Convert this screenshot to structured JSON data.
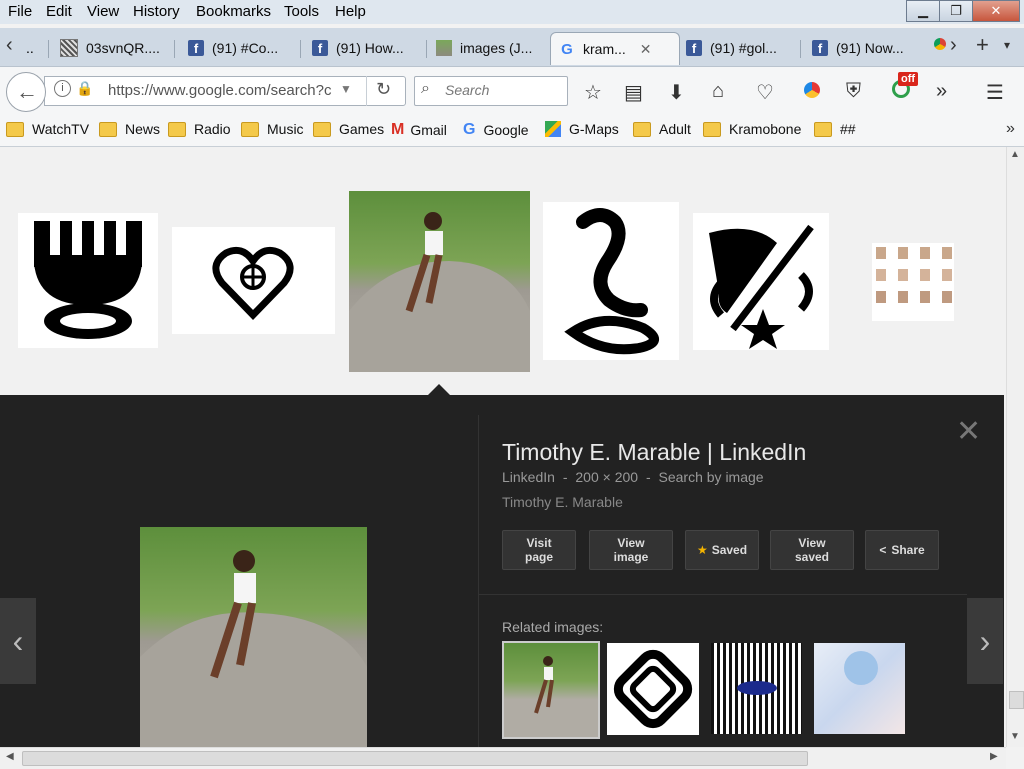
{
  "menu": {
    "file": "File",
    "edit": "Edit",
    "view": "View",
    "history": "History",
    "bookmarks": "Bookmarks",
    "tools": "Tools",
    "help": "Help"
  },
  "tabs": [
    {
      "label": "03svnQR...."
    },
    {
      "label": "(91) #Co..."
    },
    {
      "label": "(91) How..."
    },
    {
      "label": "images (J..."
    },
    {
      "label": "kram..."
    },
    {
      "label": "(91) #gol..."
    },
    {
      "label": "(91) Now..."
    }
  ],
  "toolbar": {
    "url": "https://www.google.com/search?c",
    "search_placeholder": "Search",
    "badge": "off"
  },
  "bookmarks": [
    {
      "label": "WatchTV"
    },
    {
      "label": "News"
    },
    {
      "label": "Radio"
    },
    {
      "label": "Music"
    },
    {
      "label": "Games"
    },
    {
      "label": "Gmail"
    },
    {
      "label": "Google"
    },
    {
      "label": "G-Maps"
    },
    {
      "label": "Adult"
    },
    {
      "label": "Kramobone"
    },
    {
      "label": "##"
    }
  ],
  "detail": {
    "title": "Timothy E. Marable | LinkedIn",
    "source": "LinkedIn",
    "dims": "200 × 200",
    "search_by_image": "Search by image",
    "description": "Timothy E. Marable",
    "visit_page": "Visit page",
    "view_image": "View image",
    "saved": "Saved",
    "view_saved": "View saved",
    "share": "Share",
    "related_label": "Related images:"
  },
  "colors": {
    "accent": "#3b5998",
    "dark_panel": "#222222",
    "star": "#f4b400"
  }
}
